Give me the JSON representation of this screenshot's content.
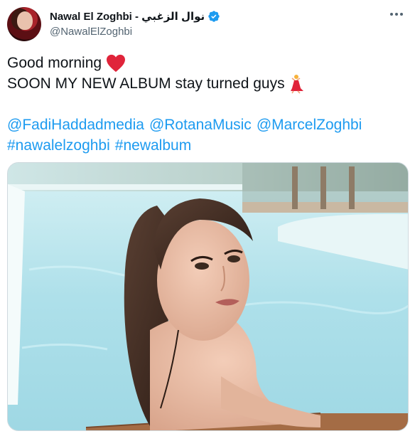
{
  "author": {
    "display_name": "Nawal El Zoghbi - نوال الزغبي",
    "handle": "@NawalElZoghbi",
    "verified": true
  },
  "tweet": {
    "line1": "Good morning",
    "line2": "SOON MY NEW ALBUM stay turned guys",
    "mentions": [
      "@FadiHaddadmedia",
      "@RotanaMusic",
      "@MarcelZoghbi"
    ],
    "hashtags": [
      "#nawalelzoghbi",
      "#newalbum"
    ]
  },
  "icons": {
    "heart": "red-heart-icon",
    "dancer": "woman-dancing-icon",
    "verified": "verified-badge-icon",
    "more": "more-options-icon"
  },
  "colors": {
    "link": "#1d9bf0",
    "text": "#0f1419",
    "secondary": "#536471",
    "heart": "#e0243a",
    "verified": "#1d9bf0"
  }
}
